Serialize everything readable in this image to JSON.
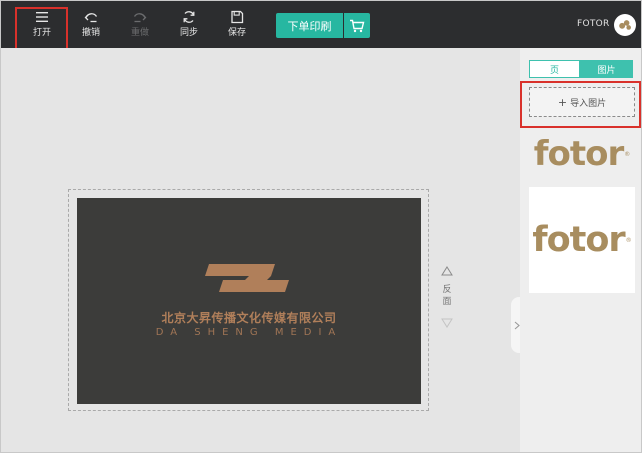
{
  "toolbar": {
    "open_label": "打开",
    "undo_label": "撤销",
    "redo_label": "重做",
    "sync_label": "同步",
    "save_label": "保存",
    "print_label": "下单印刷",
    "brand_label": "FOTOR"
  },
  "card": {
    "company_name": "北京大昇传播文化传媒有限公司",
    "company_english": "DA SHENG MEDIA",
    "logo_color": "#b07f5a"
  },
  "side_tools": {
    "flip_label": "反面"
  },
  "panel": {
    "tab_page": "页",
    "tab_image": "图片",
    "import_label": "导入图片",
    "thumb_logo_text": "fotor"
  },
  "colors": {
    "accent": "#27b7a1",
    "highlight": "#d9312b",
    "toolbar_bg": "#2c2d2f"
  }
}
